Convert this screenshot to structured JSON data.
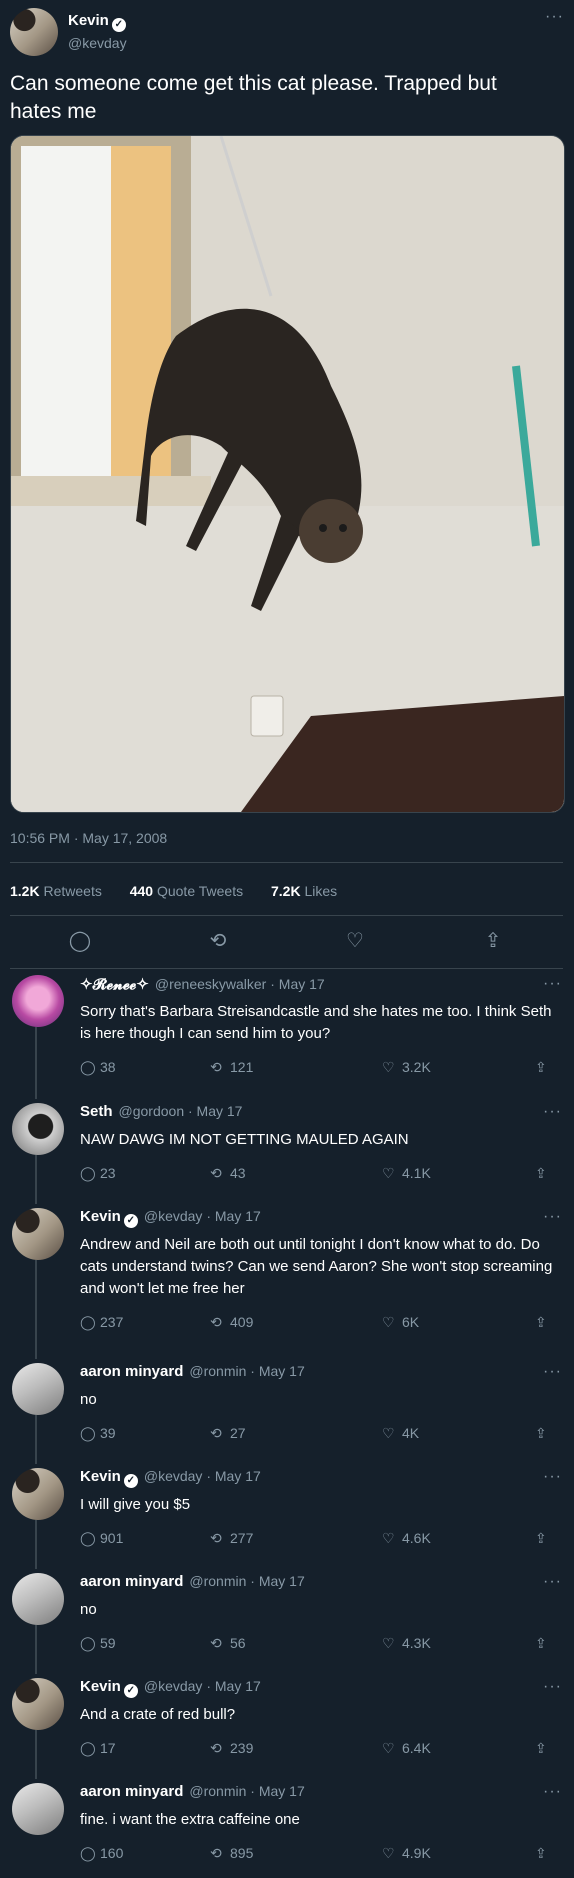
{
  "main_tweet": {
    "author_name": "Kevin",
    "handle": "@kevday",
    "text": "Can someone come get this cat please. Trapped but hates me",
    "timestamp": "10:56 PM · May 17, 2008",
    "retweets": "1.2K",
    "retweets_label": "Retweets",
    "quotes": "440",
    "quotes_label": "Quote Tweets",
    "likes": "7.2K",
    "likes_label": "Likes"
  },
  "replies": [
    {
      "name": "✧𝓡𝓮𝓷𝓮𝓮✧",
      "handle": "@reneeskywalker · May 17",
      "text": "Sorry that's Barbara Streisandcastle and she hates me too. I think Seth is here though I can send him to you?",
      "replies": "38",
      "retweets": "121",
      "likes": "3.2K",
      "avatar": "renee",
      "verified": false
    },
    {
      "name": "Seth",
      "handle": "@gordoon · May 17",
      "text": "NAW DAWG IM NOT GETTING MAULED AGAIN",
      "replies": "23",
      "retweets": "43",
      "likes": "4.1K",
      "avatar": "seth",
      "verified": false
    },
    {
      "name": "Kevin",
      "handle": "@kevday · May 17",
      "text": "Andrew and Neil are both out until tonight I don't know what to do. Do cats understand twins? Can we send Aaron? She won't stop screaming and won't let me free her",
      "replies": "237",
      "retweets": "409",
      "likes": "6K",
      "avatar": "kevin",
      "verified": true
    },
    {
      "name": "aaron minyard",
      "handle": "@ronmin · May 17",
      "text": "no",
      "replies": "39",
      "retweets": "27",
      "likes": "4K",
      "avatar": "aaron",
      "verified": false
    },
    {
      "name": "Kevin",
      "handle": "@kevday · May 17",
      "text": "I will give you $5",
      "replies": "901",
      "retweets": "277",
      "likes": "4.6K",
      "avatar": "kevin",
      "verified": true
    },
    {
      "name": "aaron minyard",
      "handle": "@ronmin · May 17",
      "text": "no",
      "replies": "59",
      "retweets": "56",
      "likes": "4.3K",
      "avatar": "aaron",
      "verified": false
    },
    {
      "name": "Kevin",
      "handle": "@kevday · May 17",
      "text": "And a crate of red bull?",
      "replies": "17",
      "retweets": "239",
      "likes": "6.4K",
      "avatar": "kevin",
      "verified": true
    },
    {
      "name": "aaron minyard",
      "handle": "@ronmin · May 17",
      "text": "fine. i want the extra caffeine one",
      "replies": "160",
      "retweets": "895",
      "likes": "4.9K",
      "avatar": "aaron",
      "verified": false
    }
  ],
  "icons": {
    "more": "more-icon",
    "reply": "reply-icon",
    "retweet": "retweet-icon",
    "like": "heart-icon",
    "share": "share-icon",
    "verified": "verified-badge"
  },
  "colors": {
    "background": "#15202b",
    "muted": "#8899a6",
    "divider": "#38444d"
  }
}
